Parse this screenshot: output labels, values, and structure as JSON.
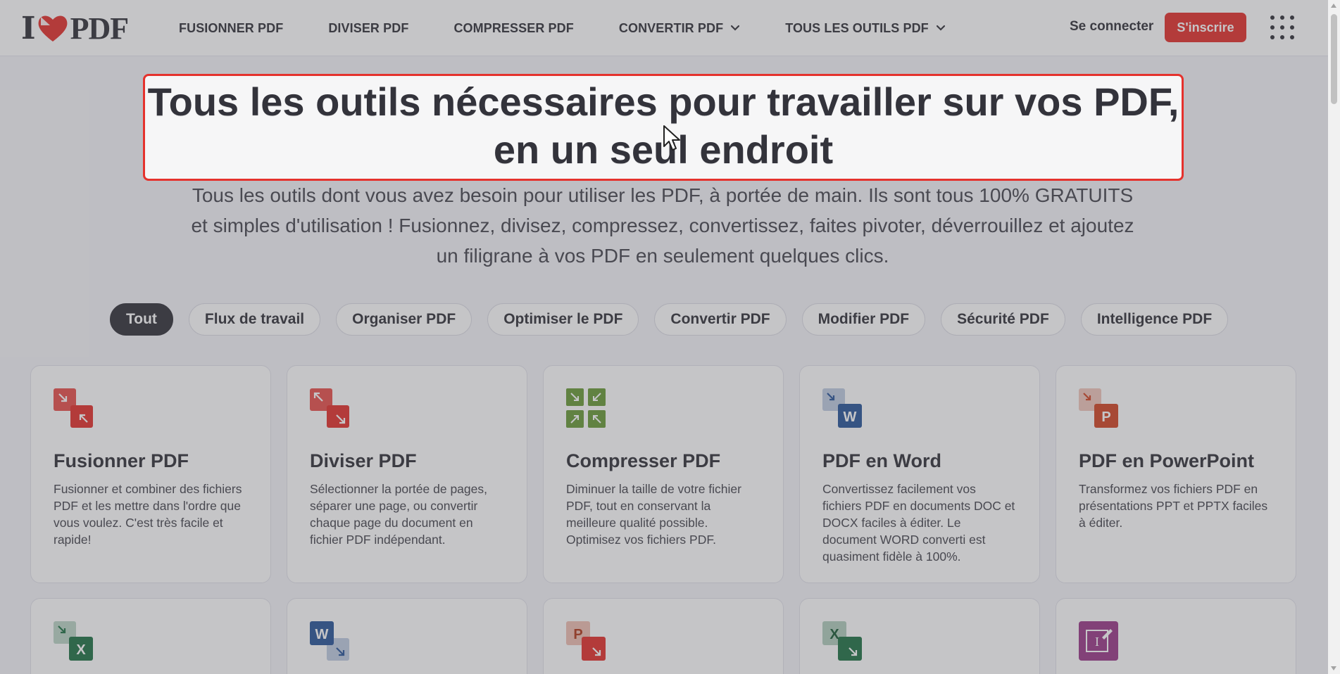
{
  "brand": {
    "logo_left": "I",
    "logo_right": "PDF",
    "accent_color": "#e5322d",
    "text_color": "#33333b"
  },
  "nav": {
    "items": [
      {
        "label": "FUSIONNER PDF",
        "dropdown": false
      },
      {
        "label": "DIVISER PDF",
        "dropdown": false
      },
      {
        "label": "COMPRESSER PDF",
        "dropdown": false
      },
      {
        "label": "CONVERTIR PDF",
        "dropdown": true
      },
      {
        "label": "TOUS LES OUTILS PDF",
        "dropdown": true
      }
    ],
    "login_label": "Se connecter",
    "signup_label": "S'inscrire",
    "apps_icon": "grid-dots-icon"
  },
  "hero": {
    "title_line1": "Tous les outils nécessaires pour travailler sur vos PDF,",
    "title_line2": "en un seul endroit",
    "subtitle": "Tous les outils dont vous avez besoin pour utiliser les PDF, à portée de main. Ils sont tous 100% GRATUITS et simples d'utilisation ! Fusionnez, divisez, compressez, convertissez, faites pivoter, déverrouillez et ajoutez un filigrane à vos PDF en seulement quelques clics."
  },
  "filters": [
    {
      "label": "Tout",
      "active": true
    },
    {
      "label": "Flux de travail",
      "active": false
    },
    {
      "label": "Organiser PDF",
      "active": false
    },
    {
      "label": "Optimiser le PDF",
      "active": false
    },
    {
      "label": "Convertir PDF",
      "active": false
    },
    {
      "label": "Modifier PDF",
      "active": false
    },
    {
      "label": "Sécurité PDF",
      "active": false
    },
    {
      "label": "Intelligence PDF",
      "active": false
    }
  ],
  "tools": [
    {
      "title": "Fusionner PDF",
      "description": "Fusionner et combiner des fichiers PDF et les mettre dans l'ordre que vous voulez. C'est très facile et rapide!",
      "icon": "merge-pdf-icon"
    },
    {
      "title": "Diviser PDF",
      "description": "Sélectionner la portée de pages, séparer une page, ou convertir chaque page du document en fichier PDF indépendant.",
      "icon": "split-pdf-icon"
    },
    {
      "title": "Compresser PDF",
      "description": "Diminuer la taille de votre fichier PDF, tout en conservant la meilleure qualité possible. Optimisez vos fichiers PDF.",
      "icon": "compress-pdf-icon"
    },
    {
      "title": "PDF en Word",
      "description": "Convertissez facilement vos fichiers PDF en documents DOC et DOCX faciles à éditer. Le document WORD converti est quasiment fidèle à 100%.",
      "icon": "pdf-to-word-icon"
    },
    {
      "title": "PDF en PowerPoint",
      "description": "Transformez vos fichiers PDF en présentations PPT et PPTX faciles à éditer.",
      "icon": "pdf-to-powerpoint-icon"
    }
  ],
  "tools_row2": [
    {
      "icon": "pdf-to-excel-icon",
      "letter": "X"
    },
    {
      "icon": "word-to-pdf-icon",
      "letter": "W"
    },
    {
      "icon": "powerpoint-to-pdf-icon",
      "letter": "P"
    },
    {
      "icon": "excel-to-pdf-icon",
      "letter": "X"
    },
    {
      "icon": "edit-pdf-icon",
      "letter": "I"
    }
  ]
}
